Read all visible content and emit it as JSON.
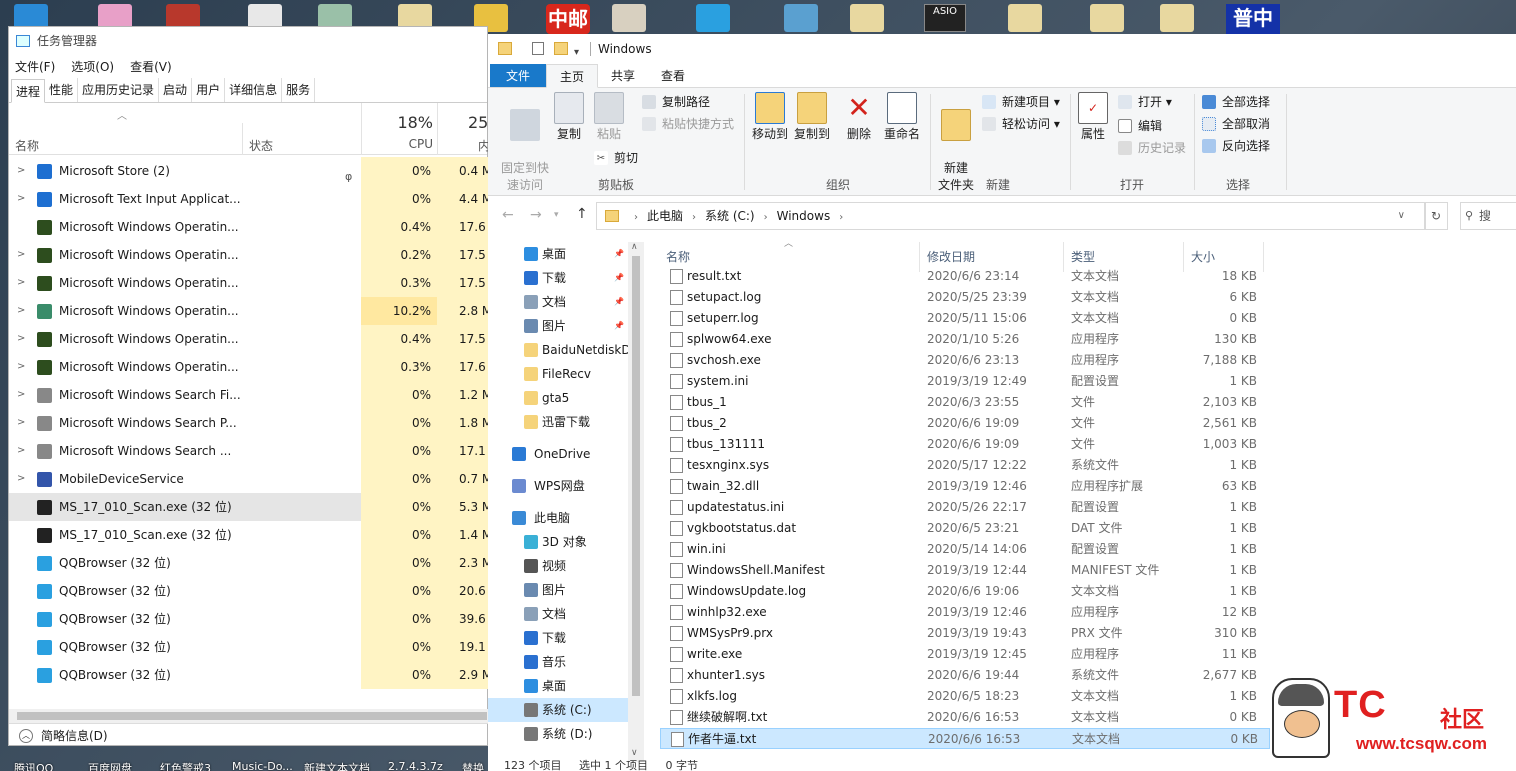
{
  "desktop": {
    "badge_text": "普中",
    "asio_text": "ASIO",
    "red_icon_text": "中邮",
    "taskbar_labels": [
      "腾讯QQ",
      "百度网盘",
      "红色警戒3",
      "Music-Do...",
      "新建文本文档",
      "2.7.4.3.7z",
      "替换"
    ]
  },
  "task_manager": {
    "title": "任务管理器",
    "menu": [
      "文件(F)",
      "选项(O)",
      "查看(V)"
    ],
    "tabs": [
      "进程",
      "性能",
      "应用历史记录",
      "启动",
      "用户",
      "详细信息",
      "服务"
    ],
    "active_tab": "进程",
    "header": {
      "name": "名称",
      "status": "状态",
      "cpu_pct": "18%",
      "cpu_label": "CPU",
      "mem_pct": "25",
      "mem_label": "内"
    },
    "processes": [
      {
        "expand": ">",
        "name": "Microsoft Store (2)",
        "cpu": "0%",
        "mem": "0.4 M",
        "icon_color": "#1e6fd1",
        "leaf": true
      },
      {
        "expand": ">",
        "name": "Microsoft Text Input Applicat...",
        "cpu": "0%",
        "mem": "4.4 M",
        "icon_color": "#1e6fd1"
      },
      {
        "expand": "",
        "name": "Microsoft Windows Operatin...",
        "cpu": "0.4%",
        "mem": "17.6 M",
        "icon_color": "#2d4d1e"
      },
      {
        "expand": ">",
        "name": "Microsoft Windows Operatin...",
        "cpu": "0.2%",
        "mem": "17.5 M",
        "icon_color": "#2d4d1e"
      },
      {
        "expand": ">",
        "name": "Microsoft Windows Operatin...",
        "cpu": "0.3%",
        "mem": "17.5 M",
        "icon_color": "#2d4d1e"
      },
      {
        "expand": ">",
        "name": "Microsoft Windows Operatin...",
        "cpu": "10.2%",
        "mem": "2.8 M",
        "icon_color": "#3a8c6a",
        "hot": true
      },
      {
        "expand": ">",
        "name": "Microsoft Windows Operatin...",
        "cpu": "0.4%",
        "mem": "17.5 M",
        "icon_color": "#2d4d1e"
      },
      {
        "expand": ">",
        "name": "Microsoft Windows Operatin...",
        "cpu": "0.3%",
        "mem": "17.6 M",
        "icon_color": "#2d4d1e"
      },
      {
        "expand": ">",
        "name": "Microsoft Windows Search Fi...",
        "cpu": "0%",
        "mem": "1.2 M",
        "icon_color": "#888888"
      },
      {
        "expand": ">",
        "name": "Microsoft Windows Search P...",
        "cpu": "0%",
        "mem": "1.8 M",
        "icon_color": "#888888"
      },
      {
        "expand": ">",
        "name": "Microsoft Windows Search ...",
        "cpu": "0%",
        "mem": "17.1 M",
        "icon_color": "#888888"
      },
      {
        "expand": ">",
        "name": "MobileDeviceService",
        "cpu": "0%",
        "mem": "0.7 M",
        "icon_color": "#3355aa"
      },
      {
        "expand": "",
        "name": "MS_17_010_Scan.exe (32 位)",
        "cpu": "0%",
        "mem": "5.3 M",
        "icon_color": "#222222",
        "selected": true
      },
      {
        "expand": "",
        "name": "MS_17_010_Scan.exe (32 位)",
        "cpu": "0%",
        "mem": "1.4 M",
        "icon_color": "#222222"
      },
      {
        "expand": "",
        "name": "QQBrowser (32 位)",
        "cpu": "0%",
        "mem": "2.3 M",
        "icon_color": "#2aa0e0"
      },
      {
        "expand": "",
        "name": "QQBrowser (32 位)",
        "cpu": "0%",
        "mem": "20.6 M",
        "icon_color": "#2aa0e0"
      },
      {
        "expand": "",
        "name": "QQBrowser (32 位)",
        "cpu": "0%",
        "mem": "39.6 M",
        "icon_color": "#2aa0e0"
      },
      {
        "expand": "",
        "name": "QQBrowser (32 位)",
        "cpu": "0%",
        "mem": "19.1 M",
        "icon_color": "#2aa0e0"
      },
      {
        "expand": "",
        "name": "QQBrowser (32 位)",
        "cpu": "0%",
        "mem": "2.9 M",
        "icon_color": "#2aa0e0"
      }
    ],
    "footer": "简略信息(D)"
  },
  "explorer": {
    "title": "Windows",
    "ribbon_tabs": [
      "文件",
      "主页",
      "共享",
      "查看"
    ],
    "ribbon": {
      "pin": "固定到快\n速访问",
      "copy": "复制",
      "paste": "粘贴",
      "copy_path": "复制路径",
      "paste_shortcut": "粘贴快捷方式",
      "cut": "剪切",
      "group_clipboard": "剪贴板",
      "move_to": "移动到",
      "copy_to": "复制到",
      "delete": "删除",
      "rename": "重命名",
      "group_organize": "组织",
      "new_folder": "新建\n文件夹",
      "new_item": "新建项目 ▾",
      "easy_access": "轻松访问 ▾",
      "group_new": "新建",
      "properties": "属性",
      "open": "打开 ▾",
      "edit": "编辑",
      "history": "历史记录",
      "group_open": "打开",
      "select_all": "全部选择",
      "select_none": "全部取消",
      "invert": "反向选择",
      "group_select": "选择"
    },
    "breadcrumb": [
      "此电脑",
      "系统 (C:)",
      "Windows"
    ],
    "search_placeholder": "搜",
    "nav": [
      {
        "label": "桌面",
        "color": "#2d8ee0",
        "pin": true
      },
      {
        "label": "下载",
        "color": "#2a70d0",
        "pin": true
      },
      {
        "label": "文档",
        "color": "#8aa0b8",
        "pin": true
      },
      {
        "label": "图片",
        "color": "#6a8ab0",
        "pin": true
      },
      {
        "label": "BaiduNetdiskD",
        "color": "#f5d37a"
      },
      {
        "label": "FileRecv",
        "color": "#f5d37a"
      },
      {
        "label": "gta5",
        "color": "#f5d37a"
      },
      {
        "label": "迅雷下载",
        "color": "#f5d37a"
      },
      {
        "label": "OneDrive",
        "color": "#2a7ad5",
        "top": true,
        "gap": true
      },
      {
        "label": "WPS网盘",
        "color": "#6b8ad0",
        "top": true,
        "gap": true
      },
      {
        "label": "此电脑",
        "color": "#3a8ad6",
        "top": true,
        "gap": true
      },
      {
        "label": "3D 对象",
        "color": "#3ab0d6"
      },
      {
        "label": "视频",
        "color": "#555555"
      },
      {
        "label": "图片",
        "color": "#6a8ab0"
      },
      {
        "label": "文档",
        "color": "#8aa0b8"
      },
      {
        "label": "下载",
        "color": "#2a70d0"
      },
      {
        "label": "音乐",
        "color": "#2a70d0"
      },
      {
        "label": "桌面",
        "color": "#2d8ee0"
      },
      {
        "label": "系统 (C:)",
        "color": "#777777",
        "selected": true
      },
      {
        "label": "系统 (D:)",
        "color": "#777777"
      }
    ],
    "columns": {
      "name": "名称",
      "date": "修改日期",
      "type": "类型",
      "size": "大小"
    },
    "files": [
      {
        "name": "result.txt",
        "date": "2020/6/6 23:14",
        "type": "文本文档",
        "size": "18 KB"
      },
      {
        "name": "setupact.log",
        "date": "2020/5/25 23:39",
        "type": "文本文档",
        "size": "6 KB"
      },
      {
        "name": "setuperr.log",
        "date": "2020/5/11 15:06",
        "type": "文本文档",
        "size": "0 KB"
      },
      {
        "name": "splwow64.exe",
        "date": "2020/1/10 5:26",
        "type": "应用程序",
        "size": "130 KB"
      },
      {
        "name": "svchosh.exe",
        "date": "2020/6/6 23:13",
        "type": "应用程序",
        "size": "7,188 KB"
      },
      {
        "name": "system.ini",
        "date": "2019/3/19 12:49",
        "type": "配置设置",
        "size": "1 KB"
      },
      {
        "name": "tbus_1",
        "date": "2020/6/3 23:55",
        "type": "文件",
        "size": "2,103 KB"
      },
      {
        "name": "tbus_2",
        "date": "2020/6/6 19:09",
        "type": "文件",
        "size": "2,561 KB"
      },
      {
        "name": "tbus_131111",
        "date": "2020/6/6 19:09",
        "type": "文件",
        "size": "1,003 KB"
      },
      {
        "name": "tesxnginx.sys",
        "date": "2020/5/17 12:22",
        "type": "系统文件",
        "size": "1 KB"
      },
      {
        "name": "twain_32.dll",
        "date": "2019/3/19 12:46",
        "type": "应用程序扩展",
        "size": "63 KB"
      },
      {
        "name": "updatestatus.ini",
        "date": "2020/5/26 22:17",
        "type": "配置设置",
        "size": "1 KB"
      },
      {
        "name": "vgkbootstatus.dat",
        "date": "2020/6/5 23:21",
        "type": "DAT 文件",
        "size": "1 KB"
      },
      {
        "name": "win.ini",
        "date": "2020/5/14 14:06",
        "type": "配置设置",
        "size": "1 KB"
      },
      {
        "name": "WindowsShell.Manifest",
        "date": "2019/3/19 12:44",
        "type": "MANIFEST 文件",
        "size": "1 KB"
      },
      {
        "name": "WindowsUpdate.log",
        "date": "2020/6/6 19:06",
        "type": "文本文档",
        "size": "1 KB"
      },
      {
        "name": "winhlp32.exe",
        "date": "2019/3/19 12:46",
        "type": "应用程序",
        "size": "12 KB"
      },
      {
        "name": "WMSysPr9.prx",
        "date": "2019/3/19 19:43",
        "type": "PRX 文件",
        "size": "310 KB"
      },
      {
        "name": "write.exe",
        "date": "2019/3/19 12:45",
        "type": "应用程序",
        "size": "11 KB"
      },
      {
        "name": "xhunter1.sys",
        "date": "2020/6/6 19:44",
        "type": "系统文件",
        "size": "2,677 KB"
      },
      {
        "name": "xlkfs.log",
        "date": "2020/6/5 18:23",
        "type": "文本文档",
        "size": "1 KB"
      },
      {
        "name": "继续破解啊.txt",
        "date": "2020/6/6 16:53",
        "type": "文本文档",
        "size": "0 KB"
      },
      {
        "name": "作者牛逼.txt",
        "date": "2020/6/6 16:53",
        "type": "文本文档",
        "size": "0 KB",
        "selected": true
      }
    ],
    "status": [
      "123 个项目",
      "选中 1 个项目",
      "0 字节"
    ]
  },
  "watermark": {
    "brand": "TC",
    "brand_suffix": "社区",
    "url": "www.tcsqw.com"
  }
}
